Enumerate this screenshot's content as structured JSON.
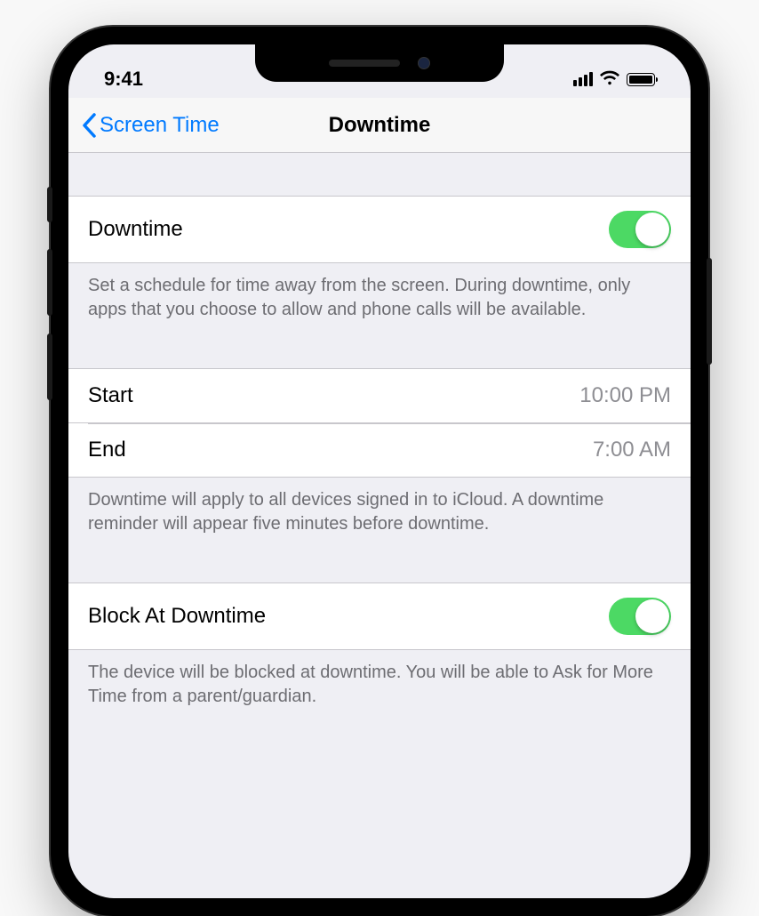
{
  "status": {
    "time": "9:41"
  },
  "nav": {
    "back_label": "Screen Time",
    "title": "Downtime"
  },
  "sections": {
    "downtime_toggle": {
      "label": "Downtime",
      "footer": "Set a schedule for time away from the screen. During downtime, only apps that you choose to allow and phone calls will be available."
    },
    "schedule": {
      "start_label": "Start",
      "start_value": "10:00 PM",
      "end_label": "End",
      "end_value": "7:00 AM",
      "footer": "Downtime will apply to all devices signed in to iCloud. A downtime reminder will appear five minutes before downtime."
    },
    "block": {
      "label": "Block At Downtime",
      "footer": "The device will be blocked at downtime. You will be able to Ask for More Time from a parent/guardian."
    }
  }
}
